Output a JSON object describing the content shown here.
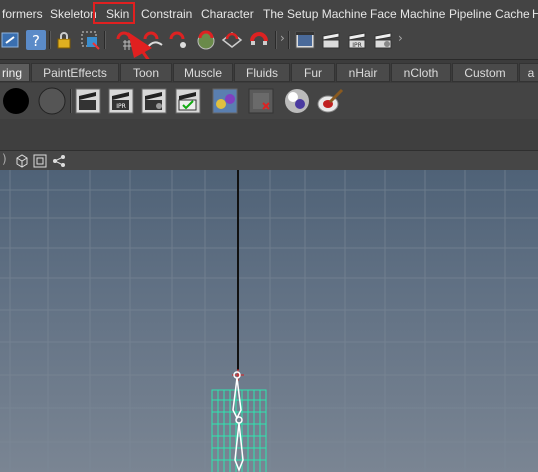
{
  "menubar": {
    "items": [
      "formers",
      "Skeleton",
      "Skin",
      "Constrain",
      "Character",
      "The Setup Machine",
      "Face Machine",
      "Pipeline Cache",
      "H"
    ]
  },
  "statusline": {
    "icons": [
      "select-by-hierarchy-icon",
      "help-query-icon",
      "lock-selection-icon",
      "select-component-icon",
      "snap-to-grid-icon",
      "snap-to-curve-icon",
      "snap-to-point-icon",
      "snap-to-surface-icon",
      "snap-view-plane-icon",
      "make-live-icon",
      "render-view-icon",
      "render-current-icon",
      "ipr-render-icon",
      "render-settings-icon"
    ]
  },
  "shelf": {
    "tabs": [
      "ring",
      "PaintEffects",
      "Toon",
      "Muscle",
      "Fluids",
      "Fur",
      "nHair",
      "nCloth",
      "Custom",
      "a"
    ],
    "active_tab": "ring"
  },
  "colors": {
    "annotation": "#e02020",
    "menubar_bg": "#444444",
    "viewport_top": "#4f6277",
    "viewport_bottom": "#7a8593",
    "joint_wire": "#2ee6b0"
  }
}
